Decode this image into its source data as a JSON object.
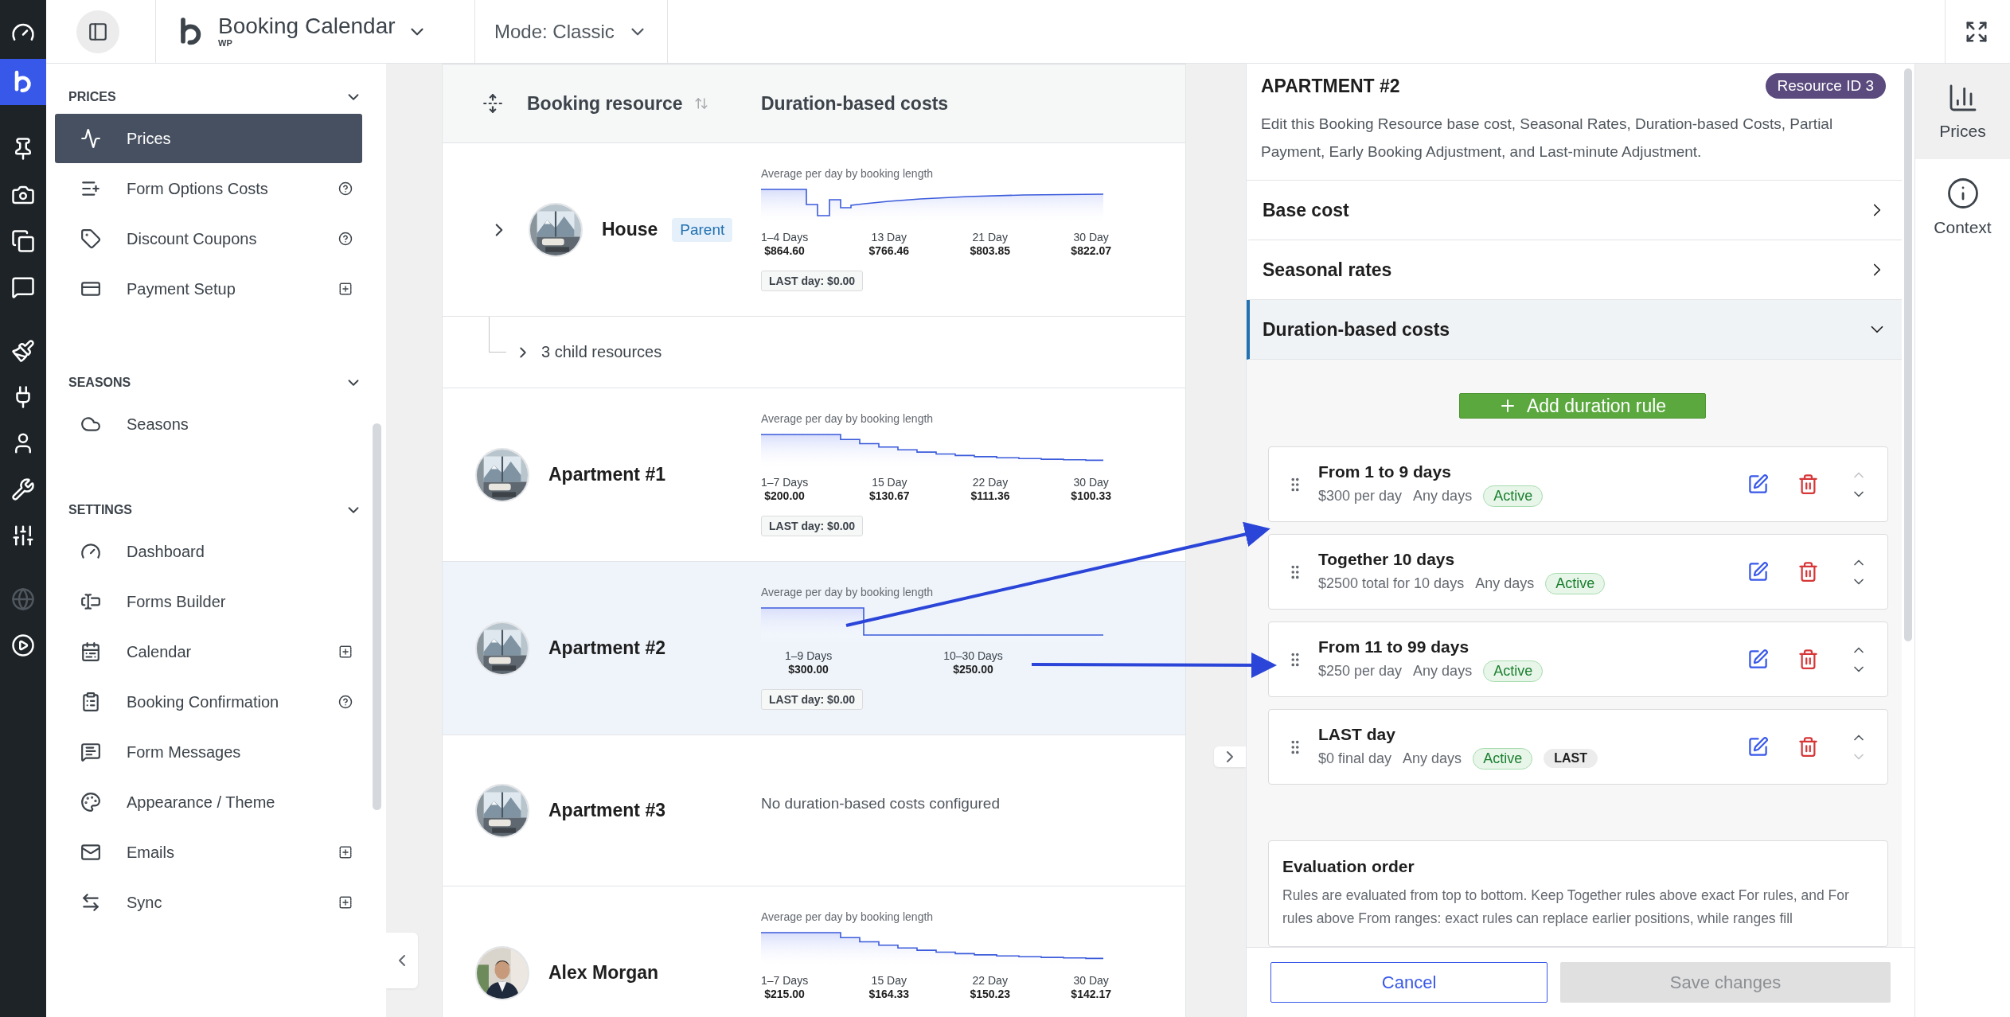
{
  "rail": {
    "items": [
      {
        "selected": false,
        "disabled": false
      },
      {
        "selected": true,
        "disabled": false
      },
      {
        "selected": false,
        "disabled": false
      },
      {
        "selected": false,
        "disabled": false
      },
      {
        "selected": false,
        "disabled": false
      },
      {
        "selected": false,
        "disabled": false
      },
      {
        "selected": false,
        "disabled": false
      },
      {
        "selected": false,
        "disabled": false
      },
      {
        "selected": false,
        "disabled": false
      },
      {
        "selected": false,
        "disabled": false
      },
      {
        "selected": false,
        "disabled": false
      },
      {
        "selected": false,
        "disabled": true
      },
      {
        "selected": false,
        "disabled": false
      }
    ]
  },
  "topbar": {
    "app_title": "Booking Calendar",
    "app_subtitle": "WP",
    "mode": "Mode: Classic"
  },
  "sidebar": {
    "sections": [
      {
        "title": "PRICES",
        "expanded": true,
        "items": [
          {
            "label": "Prices",
            "selected": true,
            "kind": "plain"
          },
          {
            "label": "Form Options Costs",
            "selected": false,
            "kind": "help"
          },
          {
            "label": "Discount Coupons",
            "selected": false,
            "kind": "help"
          },
          {
            "label": "Payment Setup",
            "selected": false,
            "kind": "add"
          }
        ]
      },
      {
        "title": "SEASONS",
        "expanded": true,
        "items": [
          {
            "label": "Seasons",
            "selected": false,
            "kind": "plain"
          }
        ]
      },
      {
        "title": "SETTINGS",
        "expanded": true,
        "items": [
          {
            "label": "Dashboard",
            "selected": false,
            "kind": "plain"
          },
          {
            "label": "Forms Builder",
            "selected": false,
            "kind": "plain"
          },
          {
            "label": "Calendar",
            "selected": false,
            "kind": "add"
          },
          {
            "label": "Booking Confirmation",
            "selected": false,
            "kind": "help"
          },
          {
            "label": "Form Messages",
            "selected": false,
            "kind": "plain"
          },
          {
            "label": "Appearance / Theme",
            "selected": false,
            "kind": "plain"
          },
          {
            "label": "Emails",
            "selected": false,
            "kind": "add"
          },
          {
            "label": "Sync",
            "selected": false,
            "kind": "add"
          }
        ]
      }
    ]
  },
  "table": {
    "columns": [
      "Booking resource",
      "Duration-based costs"
    ],
    "rows": [
      {
        "kind": "resource",
        "name": "House",
        "tag": "Parent",
        "expandable": true,
        "selected": false,
        "costs": {
          "title": "Average per day by booking length",
          "kind": "dip-rise",
          "points": [
            {
              "label": "1–4 Days",
              "value": "$864.60"
            },
            {
              "label": "13 Day",
              "value": "$766.46"
            },
            {
              "label": "21 Day",
              "value": "$803.85"
            },
            {
              "label": "30 Day",
              "value": "$822.07"
            }
          ],
          "last_day": "LAST day: $0.00"
        }
      },
      {
        "kind": "children",
        "label": "3 child resources"
      },
      {
        "kind": "resource",
        "name": "Apartment #1",
        "expandable": false,
        "selected": false,
        "costs": {
          "title": "Average per day by booking length",
          "kind": "decay",
          "points": [
            {
              "label": "1–7 Days",
              "value": "$200.00"
            },
            {
              "label": "15 Day",
              "value": "$130.67"
            },
            {
              "label": "22 Day",
              "value": "$111.36"
            },
            {
              "label": "30 Day",
              "value": "$100.33"
            }
          ],
          "last_day": "LAST day: $0.00"
        }
      },
      {
        "kind": "resource",
        "name": "Apartment #2",
        "expandable": false,
        "selected": true,
        "costs": {
          "title": "Average per day by booking length",
          "kind": "step",
          "points": [
            {
              "label": "1–9 Days",
              "value": "$300.00"
            },
            {
              "label": "10–30 Days",
              "value": "$250.00"
            }
          ],
          "last_day": "LAST day: $0.00"
        }
      },
      {
        "kind": "resource",
        "name": "Apartment #3",
        "expandable": false,
        "selected": false,
        "empty_text": "No duration-based costs configured"
      },
      {
        "kind": "resource",
        "name": "Alex Morgan",
        "expandable": false,
        "selected": false,
        "costs": {
          "title": "Average per day by booking length",
          "kind": "decay",
          "points": [
            {
              "label": "1–7 Days",
              "value": "$215.00"
            },
            {
              "label": "15 Day",
              "value": "$164.33"
            },
            {
              "label": "22 Day",
              "value": "$150.23"
            },
            {
              "label": "30 Day",
              "value": "$142.17"
            }
          ]
        }
      }
    ]
  },
  "panel": {
    "title": "APARTMENT #2",
    "badge": "Resource ID 3",
    "description": "Edit this Booking Resource base cost, Seasonal Rates, Duration-based Costs, Partial Payment, Early Booking Adjustment, and Last-minute Adjustment.",
    "sections": [
      {
        "label": "Base cost",
        "expanded": false
      },
      {
        "label": "Seasonal rates",
        "expanded": false
      },
      {
        "label": "Duration-based costs",
        "expanded": true
      }
    ],
    "add_button": "Add duration rule",
    "rules": [
      {
        "title": "From 1 to 9 days",
        "details": [
          "$300 per day",
          "Any days"
        ],
        "tags": [
          {
            "text": "Active",
            "kind": "active"
          }
        ],
        "can_move_up": false,
        "can_move_down": true
      },
      {
        "title": "Together 10 days",
        "details": [
          "$2500 total for 10 days",
          "Any days"
        ],
        "tags": [
          {
            "text": "Active",
            "kind": "active"
          }
        ],
        "can_move_up": true,
        "can_move_down": true
      },
      {
        "title": "From 11 to 99 days",
        "details": [
          "$250 per day",
          "Any days"
        ],
        "tags": [
          {
            "text": "Active",
            "kind": "active"
          }
        ],
        "can_move_up": true,
        "can_move_down": true
      },
      {
        "title": "LAST day",
        "details": [
          "$0 final day",
          "Any days"
        ],
        "tags": [
          {
            "text": "Active",
            "kind": "active"
          },
          {
            "text": "LAST",
            "kind": "neutral"
          }
        ],
        "can_move_up": true,
        "can_move_down": false
      }
    ],
    "note": {
      "title": "Evaluation order",
      "text": "Rules are evaluated from top to bottom. Keep Together rules above exact For rules, and For rules above From ranges: exact rules can replace earlier positions, while ranges fill"
    },
    "footer": {
      "cancel": "Cancel",
      "save": "Save changes",
      "save_disabled": true
    }
  },
  "right_rail": {
    "tabs": [
      {
        "label": "Prices",
        "selected": true
      },
      {
        "label": "Context",
        "selected": false
      }
    ]
  }
}
